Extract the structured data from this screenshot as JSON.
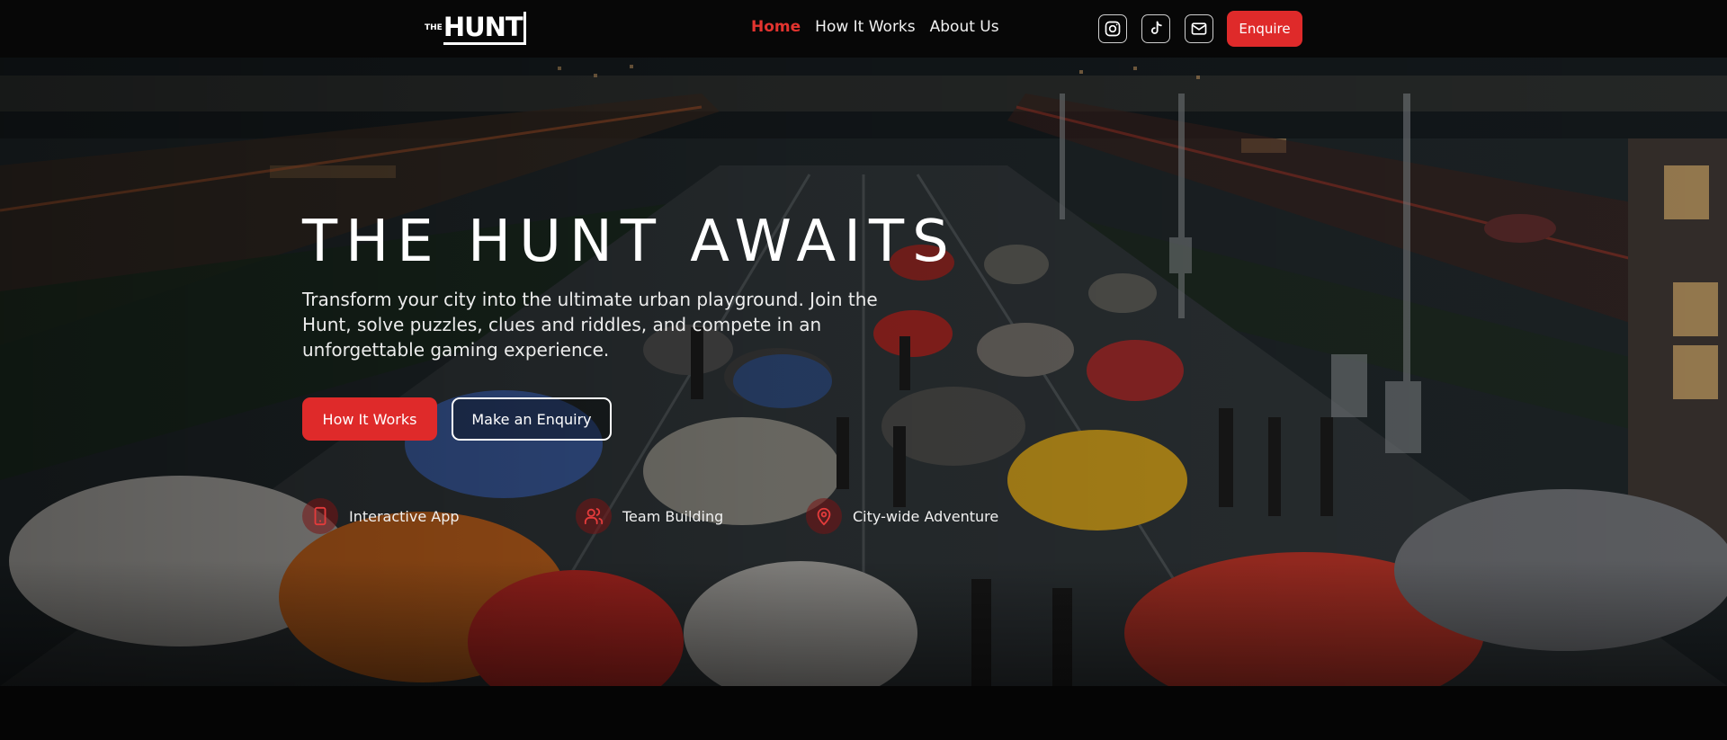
{
  "brand": {
    "logo_small": "THE",
    "logo_big": "HUNT"
  },
  "nav": {
    "links": [
      {
        "label": "Home",
        "active": true
      },
      {
        "label": "How It Works",
        "active": false
      },
      {
        "label": "About Us",
        "active": false
      }
    ],
    "social_icons": [
      "instagram-icon",
      "tiktok-icon",
      "mail-icon"
    ],
    "enquire_label": "Enquire"
  },
  "hero": {
    "title": "THE HUNT AWAITS",
    "description": "Transform your city into the ultimate urban playground. Join the Hunt, solve puzzles, clues and riddles, and compete in an unforgettable gaming experience.",
    "primary_button": "How It Works",
    "secondary_button": "Make an Enquiry",
    "features": [
      {
        "label": "Interactive App",
        "icon": "smartphone-icon"
      },
      {
        "label": "Team Building",
        "icon": "users-icon"
      },
      {
        "label": "City-wide Adventure",
        "icon": "map-pin-icon"
      }
    ]
  },
  "colors": {
    "accent": "#df2a2a",
    "nav_bg": "#070707",
    "page_bg": "#050505"
  }
}
